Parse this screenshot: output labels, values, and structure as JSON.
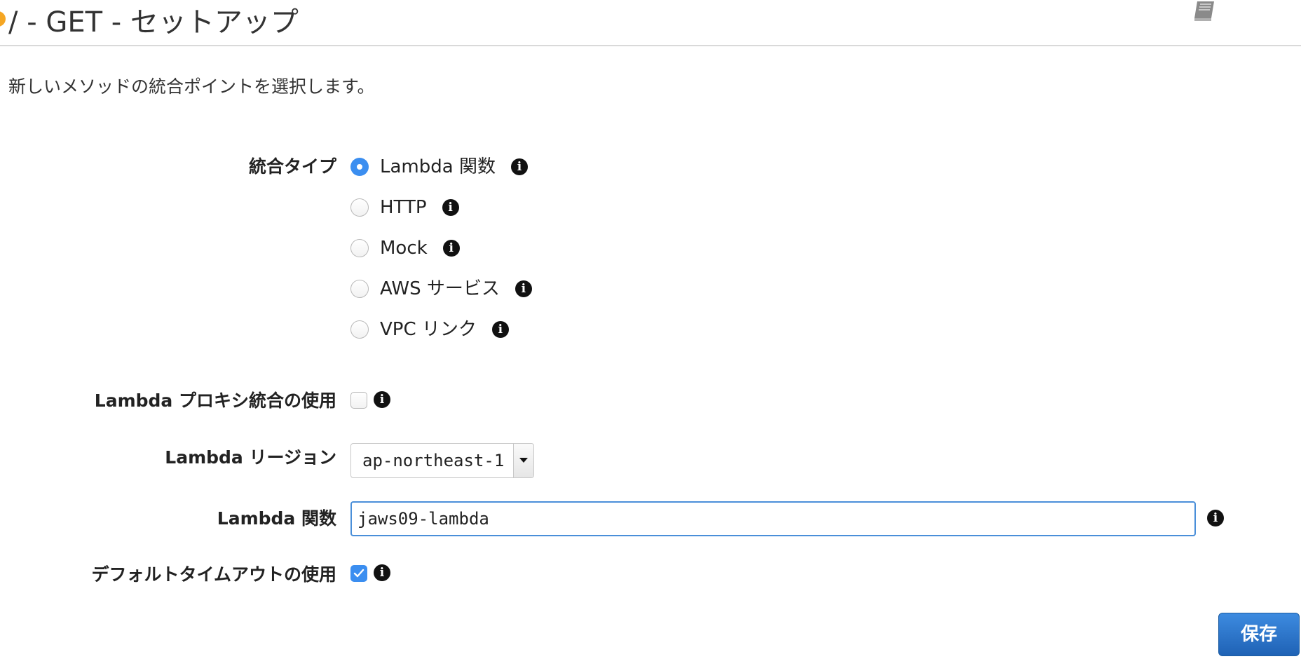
{
  "header": {
    "title": "/ - GET - セットアップ",
    "status_dot_color": "#f5a623",
    "docs_icon": "book-icon"
  },
  "description": "新しいメソッドの統合ポイントを選択します。",
  "form": {
    "integration_type": {
      "label": "統合タイプ",
      "selected": "Lambda 関数",
      "options": [
        {
          "label": "Lambda 関数",
          "checked": true
        },
        {
          "label": "HTTP",
          "checked": false
        },
        {
          "label": "Mock",
          "checked": false
        },
        {
          "label": "AWS サービス",
          "checked": false
        },
        {
          "label": "VPC リンク",
          "checked": false
        }
      ]
    },
    "lambda_proxy": {
      "label": "Lambda プロキシ統合の使用",
      "checked": false
    },
    "lambda_region": {
      "label": "Lambda リージョン",
      "value": "ap-northeast-1"
    },
    "lambda_function": {
      "label": "Lambda 関数",
      "value": "jaws09-lambda"
    },
    "default_timeout": {
      "label": "デフォルトタイムアウトの使用",
      "checked": true
    },
    "info_glyph": "i"
  },
  "actions": {
    "save_label": "保存",
    "accent_color": "#2a74c9"
  }
}
